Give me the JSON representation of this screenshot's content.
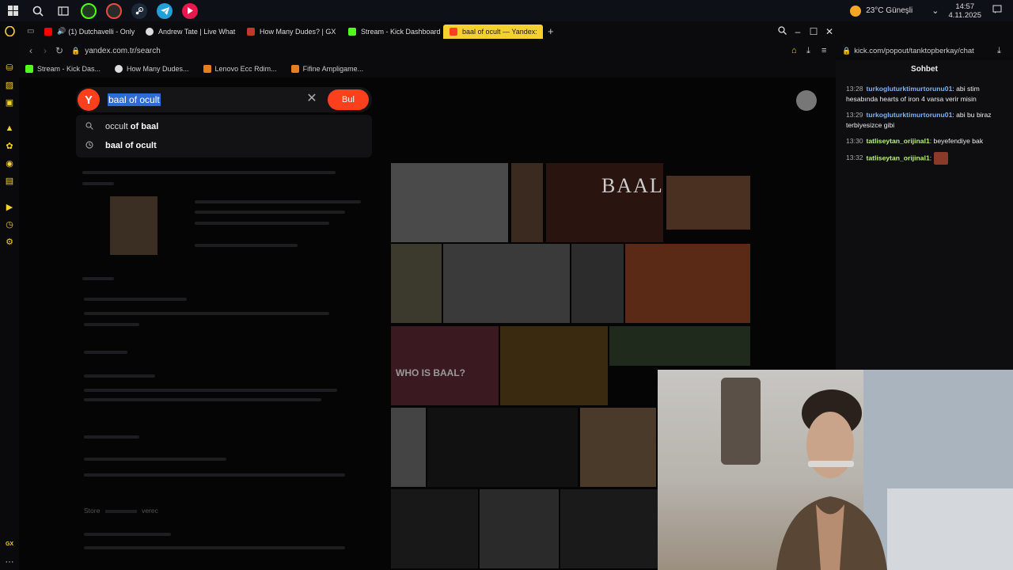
{
  "taskbar": {
    "weather": "23°C  Güneşli",
    "time": "14:57",
    "date": "4.11.2025"
  },
  "tabs": [
    {
      "label": "(1) Dutchavelli - Only",
      "color": "#ff0000"
    },
    {
      "label": "Andrew Tate | Live What",
      "color": "#dddddd"
    },
    {
      "label": "How Many Dudes? | GX",
      "color": "#c0392b"
    },
    {
      "label": "Stream - Kick Dashboard",
      "color": "#53fc18"
    },
    {
      "label": "baal of ocult — Yandex:",
      "color": "#fc3f1d",
      "active": true
    }
  ],
  "address": {
    "url": "yandex.com.tr/search"
  },
  "bookmarks": [
    {
      "label": "Stream - Kick Das...",
      "color": "#53fc18"
    },
    {
      "label": "How Many Dudes...",
      "color": "#dddddd"
    },
    {
      "label": "Lenovo Ecc Rdim...",
      "color": "#e67e22"
    },
    {
      "label": "Fifine Ampligame...",
      "color": "#e67e22"
    }
  ],
  "search": {
    "logo": "Y",
    "query": "baal of ocult",
    "button": "Bul",
    "suggestions": [
      {
        "normal": "occult ",
        "bold": "of baal",
        "icon": "search-icon"
      },
      {
        "normal": "",
        "bold": "baal of ocult",
        "icon": "history-icon"
      }
    ]
  },
  "results": {
    "left_label": "Store",
    "left_label2": "verec",
    "image_label": "BAAL",
    "image_label2": "WHO IS BAAL?"
  },
  "chat": {
    "url": "kick.com/popout/tanktopberkay/chat",
    "title": "Sohbet",
    "messages": [
      {
        "time": "13:28",
        "user": "turkogluturktimurtorunu01",
        "text": "abi stim hesabında hearts of iron 4 varsa verir misin",
        "user_color": "#7fb2f0"
      },
      {
        "time": "13:29",
        "user": "turkogluturktimurtorunu01",
        "text": "abi bu biraz terbiyesizce gibi",
        "user_color": "#7fb2f0"
      },
      {
        "time": "13:30",
        "user": "tatliseytan_orijinal1",
        "text": "beyefendiye bak",
        "user_color": "#b8f07f"
      },
      {
        "time": "13:32",
        "user": "tatliseytan_orijinal1",
        "text": "",
        "user_color": "#b8f07f",
        "emote": true
      }
    ]
  },
  "sidebar": {
    "gx_label": "GX"
  }
}
